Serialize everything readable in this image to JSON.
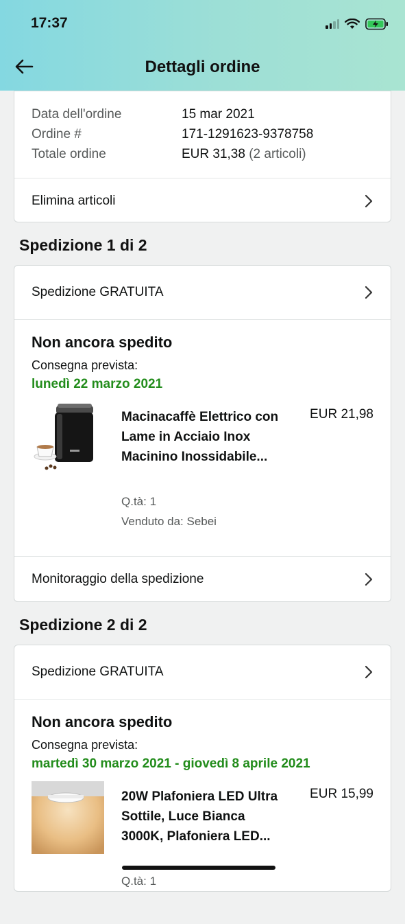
{
  "status_bar": {
    "time": "17:37",
    "battery_color": "#34c759"
  },
  "header": {
    "title": "Dettagli ordine"
  },
  "order_summary": {
    "rows": [
      {
        "label": "Data dell'ordine",
        "value": "15 mar 2021"
      },
      {
        "label": "Ordine #",
        "value": "171-1291623-9378758"
      },
      {
        "label": "Totale ordine",
        "value": "EUR 31,38",
        "extra": "(2 articoli)"
      }
    ],
    "delete_items_label": "Elimina articoli"
  },
  "shipments": [
    {
      "heading": "Spedizione 1 di 2",
      "shipping_label": "Spedizione GRATUITA",
      "status": "Non ancora spedito",
      "delivery_label": "Consegna prevista:",
      "delivery_date": "lunedì 22 marzo 2021",
      "item": {
        "title": "Macinacaffè Elettrico con Lame in Acciaio Inox Macinino Inossidabile...",
        "price": "EUR 21,98",
        "quantity": "Q.tà: 1",
        "seller": "Venduto da: Sebei"
      },
      "tracking_label": "Monitoraggio della spedizione"
    },
    {
      "heading": "Spedizione 2 di 2",
      "shipping_label": "Spedizione GRATUITA",
      "status": "Non ancora spedito",
      "delivery_label": "Consegna prevista:",
      "delivery_date": "martedì 30 marzo 2021 - giovedì 8 aprile 2021",
      "item": {
        "title": "20W Plafoniera LED Ultra Sottile, Luce Bianca 3000K, Plafoniera LED...",
        "price": "EUR 15,99",
        "quantity": "Q.tà: 1"
      }
    }
  ],
  "colors": {
    "delivery_green": "#228c1b",
    "text": "#0f1111",
    "muted": "#565959"
  }
}
